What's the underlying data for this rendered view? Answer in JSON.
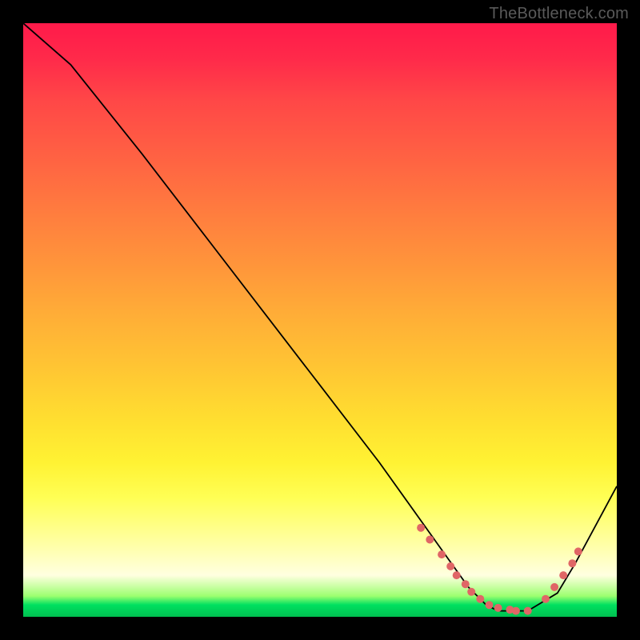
{
  "watermark": "TheBottleneck.com",
  "colors": {
    "dot": "#e06666",
    "curve": "#000000"
  },
  "chart_data": {
    "type": "line",
    "title": "",
    "xlabel": "",
    "ylabel": "",
    "xlim": [
      0,
      100
    ],
    "ylim": [
      0,
      100
    ],
    "series": [
      {
        "name": "bottleneck-curve",
        "x": [
          0,
          8,
          20,
          30,
          40,
          50,
          60,
          65,
          70,
          75,
          78,
          80,
          85,
          90,
          93,
          100
        ],
        "y": [
          100,
          93,
          78,
          65,
          52,
          39,
          26,
          19,
          12,
          5,
          2,
          1,
          1,
          4,
          9,
          22
        ]
      }
    ],
    "markers": {
      "name": "highlight-dots",
      "x": [
        67,
        68.5,
        70.5,
        72,
        73,
        74.5,
        75.5,
        77,
        78.5,
        80,
        82,
        83,
        85,
        88,
        89.5,
        91,
        92.5,
        93.5
      ],
      "y": [
        15,
        13,
        10.5,
        8.5,
        7,
        5.5,
        4.2,
        3,
        2,
        1.5,
        1.2,
        1,
        1,
        3,
        5,
        7,
        9,
        11
      ]
    },
    "annotations": []
  }
}
